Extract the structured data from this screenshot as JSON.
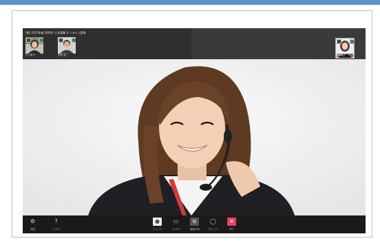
{
  "meeting": {
    "title": "(株) 2021年度 OOA学 入学試験 オンライン面接"
  },
  "participants": [
    {
      "name": "川上恵子",
      "mic_icon": "mic-icon",
      "camera_icon": "camera-icon"
    },
    {
      "name": "宮野 恵二",
      "mic_icon": "mic-icon",
      "camera_icon": "camera-icon"
    }
  ],
  "self_view": {
    "name": "松本典子"
  },
  "toolbar": {
    "settings_label": "設定",
    "help_label": "ヘルプ",
    "mute_label": "ミュート",
    "camera_label": "カメラ",
    "share_label": "画面共有",
    "chat_label": "チャット",
    "end_label": "終了"
  },
  "colors": {
    "accent_bar": "#5b93cf",
    "end_button": "#e0445e",
    "app_background": "#1e1e1e"
  }
}
